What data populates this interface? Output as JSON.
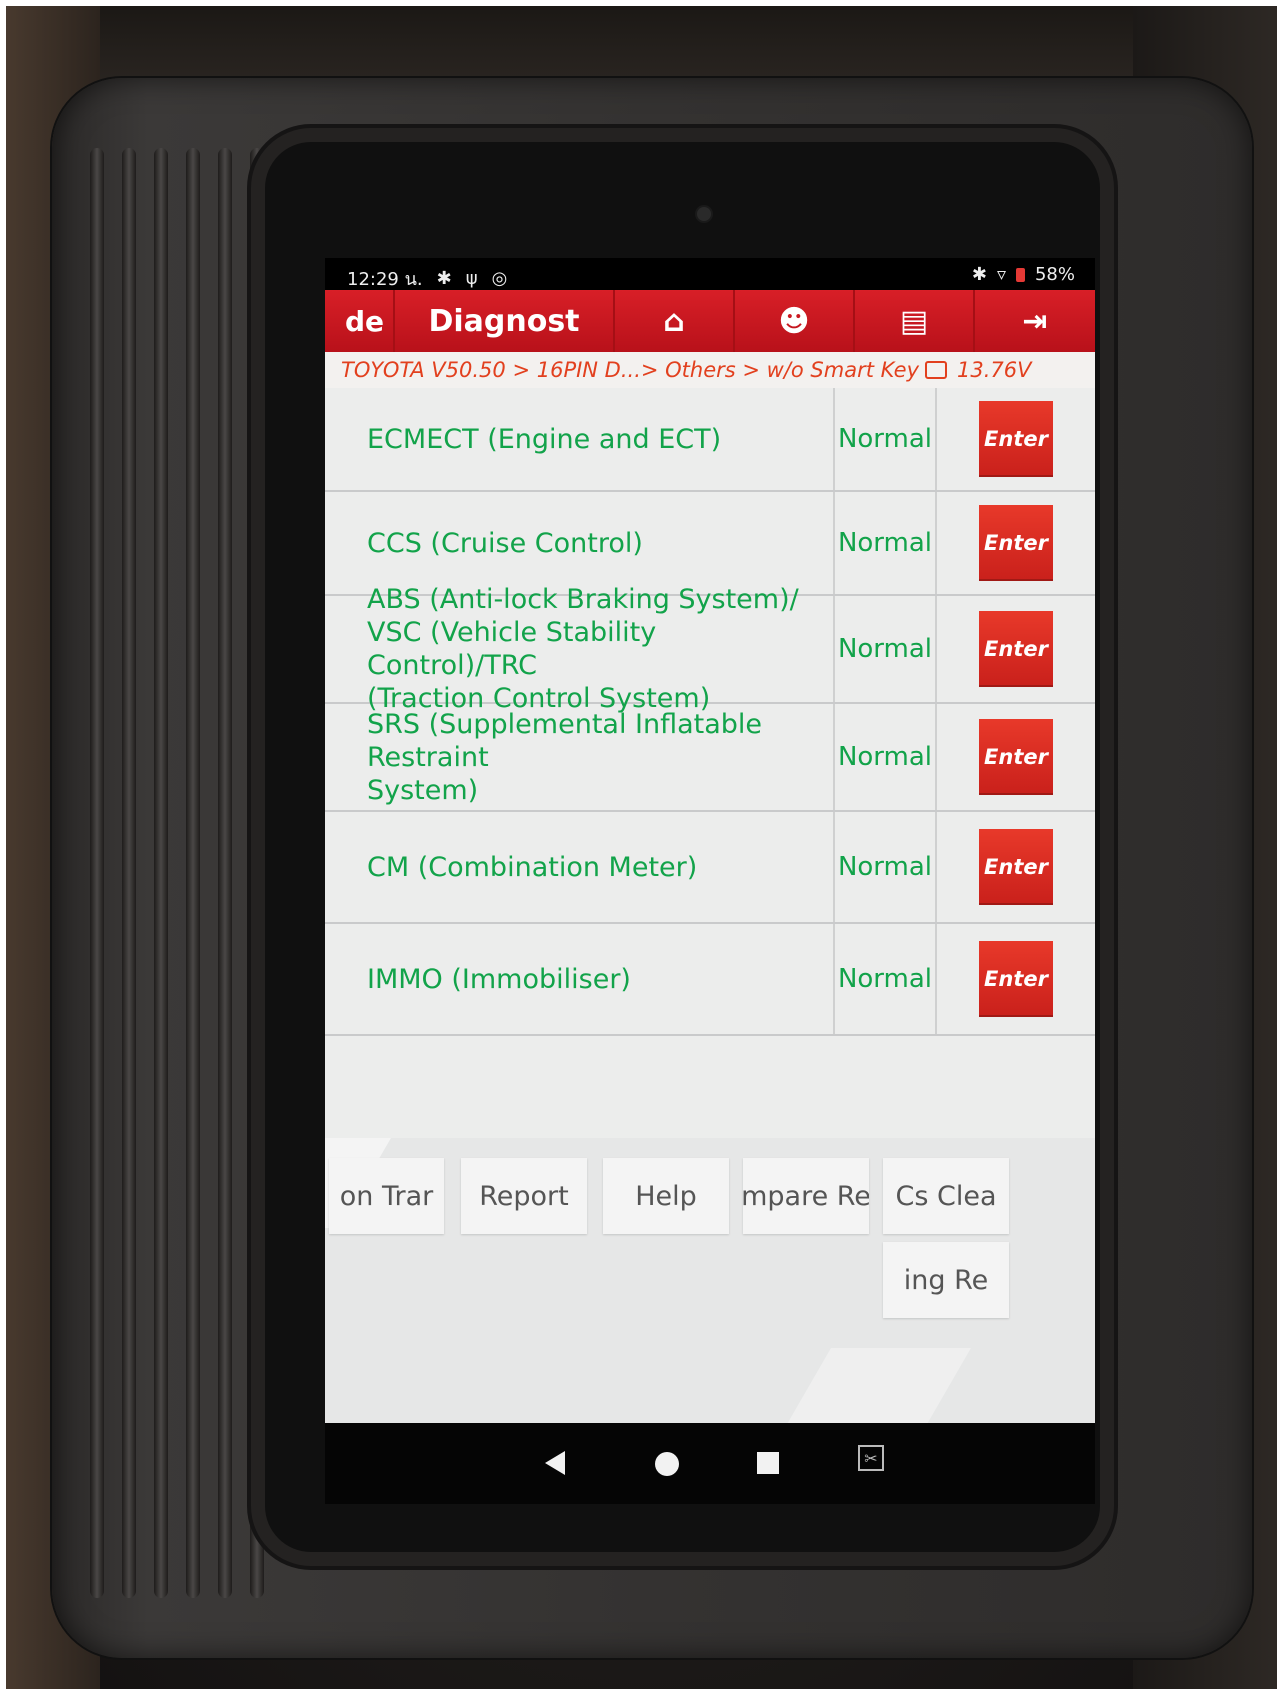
{
  "statusbar": {
    "time": "12:29 น.",
    "left_icons": [
      "gear-icon",
      "usb-icon",
      "sync-icon"
    ],
    "right_icons": [
      "bluetooth-icon",
      "wifi-icon"
    ],
    "battery": "58%"
  },
  "toolbar": {
    "back_label": "de",
    "title": "Diagnost",
    "icons": [
      "home-icon",
      "support-icon",
      "print-icon",
      "exit-icon"
    ]
  },
  "breadcrumb": {
    "path": "TOYOTA V50.50 > 16PIN D...> Others > w/o Smart Key",
    "voltage": "13.76V"
  },
  "systems": [
    {
      "name_lines": [
        "ECMECT (Engine and ECT)"
      ],
      "status": "Normal",
      "action": "Enter"
    },
    {
      "name_lines": [
        "CCS (Cruise Control)"
      ],
      "status": "Normal",
      "action": "Enter"
    },
    {
      "name_lines": [
        "ABS (Anti-lock Braking System)/",
        "VSC (Vehicle Stability Control)/TRC",
        "(Traction Control System)"
      ],
      "status": "Normal",
      "action": "Enter"
    },
    {
      "name_lines": [
        "SRS (Supplemental Inflatable Restraint",
        "System)"
      ],
      "status": "Normal",
      "action": "Enter"
    },
    {
      "name_lines": [
        "CM (Combination Meter)"
      ],
      "status": "Normal",
      "action": "Enter"
    },
    {
      "name_lines": [
        "IMMO (Immobiliser)"
      ],
      "status": "Normal",
      "action": "Enter"
    }
  ],
  "bottom_buttons": {
    "b1": "on    Trar",
    "report": "Report",
    "help": "Help",
    "compare": "mpare Re",
    "clear": "Cs    Clea",
    "reading": "ing    Re"
  },
  "navbar": {
    "icons": [
      "back-icon",
      "home-circle-icon",
      "recent-apps-icon",
      "screenshot-icon"
    ],
    "screenshot_glyph": "✂"
  }
}
